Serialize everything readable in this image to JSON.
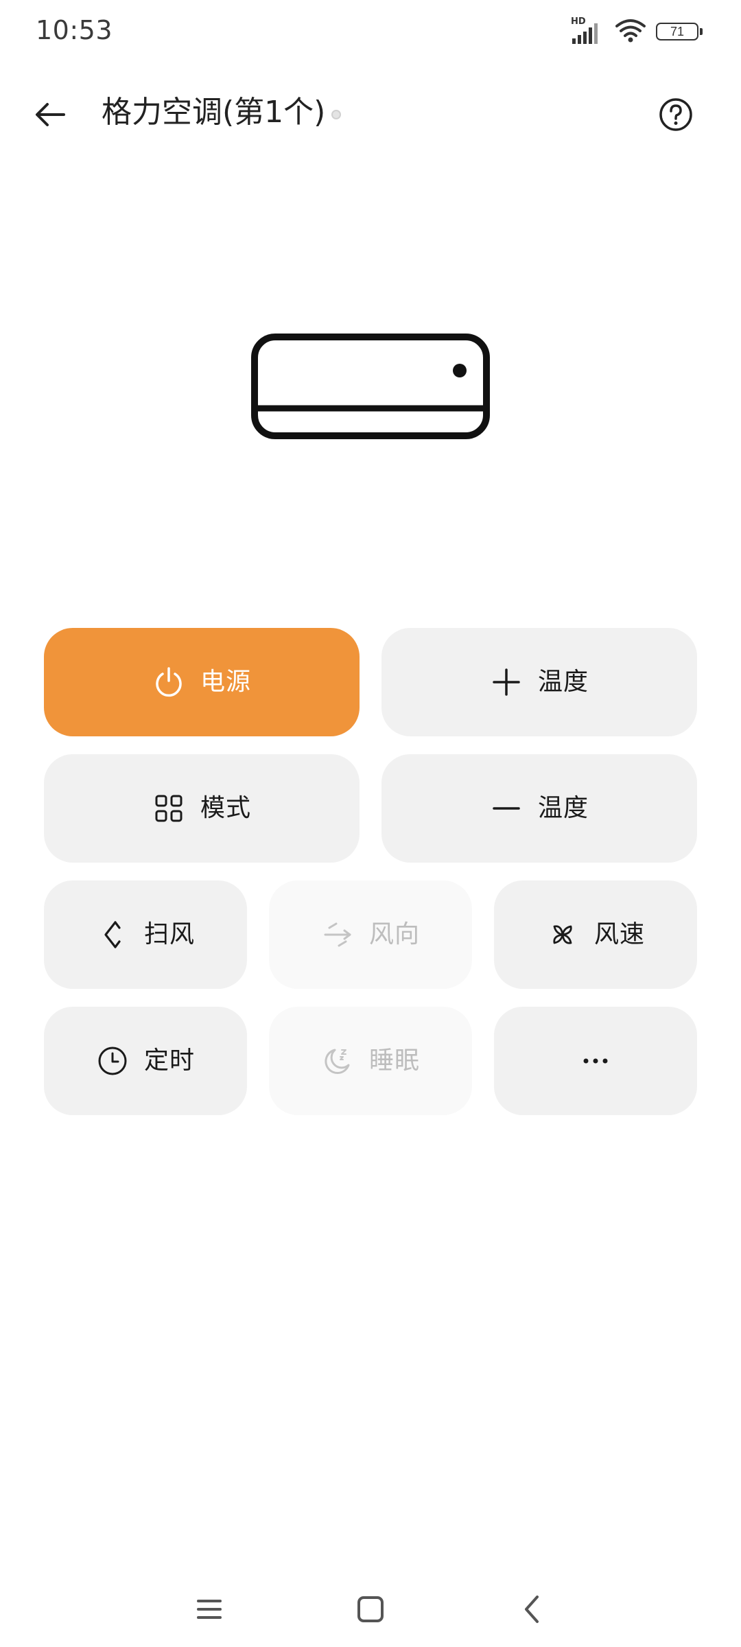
{
  "status_bar": {
    "time": "10:53",
    "network_badge": "HD",
    "battery_level": "71",
    "icons": [
      "signal-icon",
      "wifi-icon",
      "battery-icon"
    ]
  },
  "header": {
    "title": "格力空调(第1个)",
    "back_icon": "back-arrow-icon",
    "help_icon": "help-icon"
  },
  "illustration": {
    "icon": "air-conditioner-icon"
  },
  "controls": {
    "power": {
      "label": "电源",
      "icon": "power-icon",
      "state": "active"
    },
    "temp_up": {
      "label": "温度",
      "icon": "plus-icon"
    },
    "mode": {
      "label": "模式",
      "icon": "grid-icon"
    },
    "temp_down": {
      "label": "温度",
      "icon": "minus-icon"
    },
    "swing": {
      "label": "扫风",
      "icon": "swing-icon"
    },
    "direction": {
      "label": "风向",
      "icon": "direction-icon",
      "state": "disabled"
    },
    "fan_speed": {
      "label": "风速",
      "icon": "fan-icon"
    },
    "timer": {
      "label": "定时",
      "icon": "clock-icon"
    },
    "sleep": {
      "label": "睡眠",
      "icon": "moon-icon",
      "state": "disabled"
    },
    "more": {
      "label": "···",
      "icon": "more-icon"
    }
  },
  "colors": {
    "accent": "#f0943a",
    "button_bg": "#f1f1f1",
    "disabled_bg": "#f9f9f9",
    "disabled_text": "#bdbdbd"
  },
  "nav_bar": {
    "items": [
      "menu-icon",
      "home-icon",
      "back-icon"
    ]
  }
}
